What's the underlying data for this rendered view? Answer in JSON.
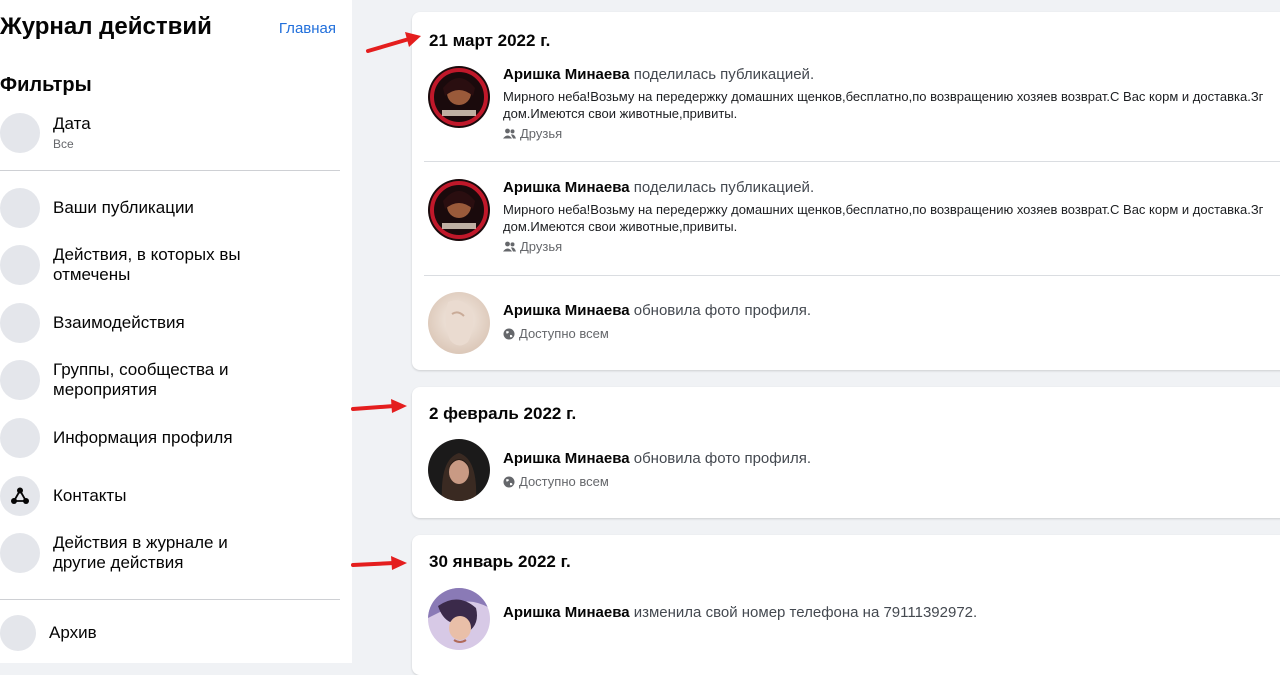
{
  "sidebar": {
    "title": "Журнал действий",
    "home_link": "Главная",
    "filters_heading": "Фильтры",
    "items": [
      {
        "label": "Дата",
        "sub": "Все"
      },
      {
        "label": "Ваши публикации"
      },
      {
        "label": "Действия, в которых вы отмечены"
      },
      {
        "label": "Взаимодействия"
      },
      {
        "label": "Группы, сообщества и мероприятия"
      },
      {
        "label": "Информация профиля"
      },
      {
        "label": "Контакты"
      },
      {
        "label": "Действия в журнале и другие действия"
      },
      {
        "label": "Архив"
      }
    ]
  },
  "groups": [
    {
      "date": "21 март 2022 г.",
      "entries": [
        {
          "name": "Аришка Минаева",
          "action": "поделилась публикацией.",
          "desc": "Мирного неба!Возьму на передержку домашних щенков,бесплатно,по возвращению хозяев возврат.С Вас корм и доставка.Зг",
          "desc2": "дом.Имеются свои животные,привиты.",
          "audience": "Друзья",
          "audience_icon": "friends-icon"
        },
        {
          "name": "Аришка Минаева",
          "action": "поделилась публикацией.",
          "desc": "Мирного неба!Возьму на передержку домашних щенков,бесплатно,по возвращению хозяев возврат.С Вас корм и доставка.Зг",
          "desc2": "дом.Имеются свои животные,привиты.",
          "audience": "Друзья",
          "audience_icon": "friends-icon"
        },
        {
          "name": "Аришка Минаева",
          "action": "обновила фото профиля.",
          "audience": "Доступно всем",
          "audience_icon": "globe-icon"
        }
      ]
    },
    {
      "date": "2 февраль 2022 г.",
      "entries": [
        {
          "name": "Аришка Минаева",
          "action": "обновила фото профиля.",
          "audience": "Доступно всем",
          "audience_icon": "globe-icon"
        }
      ]
    },
    {
      "date": "30 январь 2022 г.",
      "entries": [
        {
          "name": "Аришка Минаева",
          "action": "изменила свой номер телефона на 79111392972."
        }
      ]
    }
  ],
  "colors": {
    "background": "#f0f2f5",
    "link": "#216fdb",
    "annotation_arrow": "#e41e1e",
    "secondary_text": "#65676b"
  }
}
